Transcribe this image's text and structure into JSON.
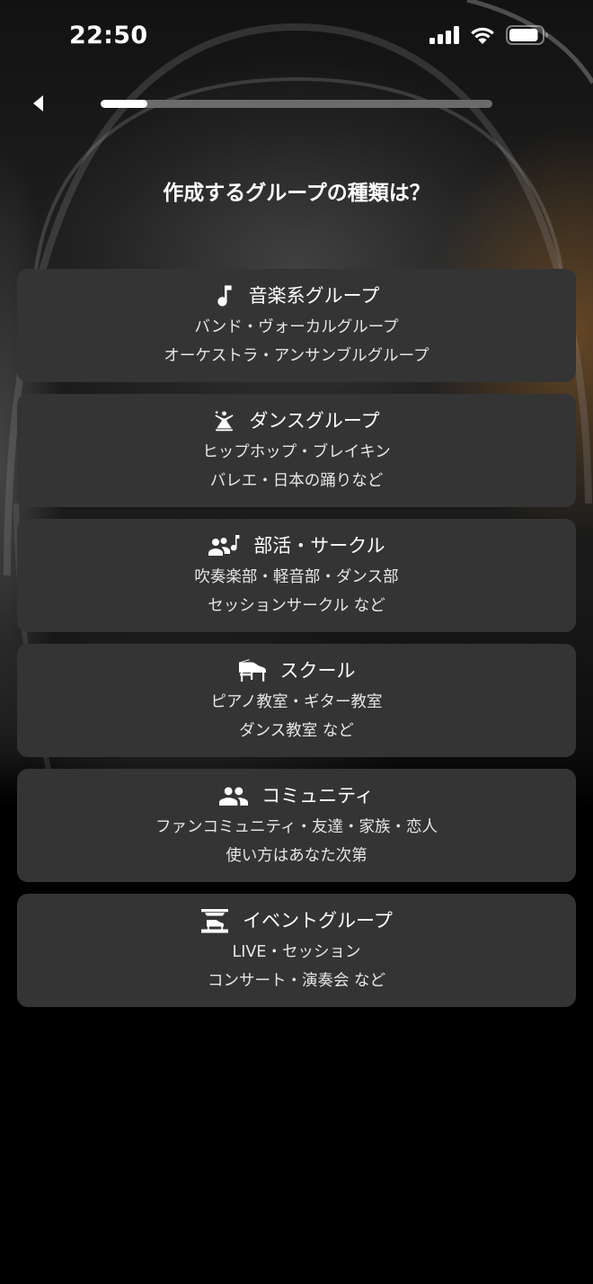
{
  "status_bar": {
    "time": "22:50",
    "icons": [
      "cellular-signal-icon",
      "wifi-icon",
      "battery-icon"
    ],
    "battery_level": 0.9
  },
  "header": {
    "back_icon": "back-triangle-icon",
    "progress": 0.12
  },
  "title": "作成するグループの種類は？",
  "options": [
    {
      "icon": "music-note-icon",
      "title": "音楽系グループ",
      "lines": [
        "バンド・ヴォーカルグループ",
        "オーケストラ・アンサンブルグループ"
      ]
    },
    {
      "icon": "dancer-icon",
      "title": "ダンスグループ",
      "lines": [
        "ヒップホップ・ブレイキン",
        "バレエ・日本の踊りなど"
      ]
    },
    {
      "icon": "people-music-icon",
      "title": "部活・サークル",
      "lines": [
        "吹奏楽部・軽音部・ダンス部",
        "セッションサークル など"
      ]
    },
    {
      "icon": "grand-piano-icon",
      "title": "スクール",
      "lines": [
        "ピアノ教室・ギター教室",
        "ダンス教室 など"
      ]
    },
    {
      "icon": "group-icon",
      "title": "コミュニティ",
      "lines": [
        "ファンコミュニティ・友達・家族・恋人",
        "使い方はあなた次第"
      ]
    },
    {
      "icon": "stage-event-icon",
      "title": "イベントグループ",
      "lines": [
        "LIVE・セッション",
        "コンサート・演奏会 など"
      ]
    }
  ],
  "colors": {
    "background": "#000000",
    "card": "#343434",
    "text": "#ffffff",
    "subtext": "#e6e6e6",
    "progress_track": "#6b6b6b",
    "progress_fill": "#ffffff"
  }
}
